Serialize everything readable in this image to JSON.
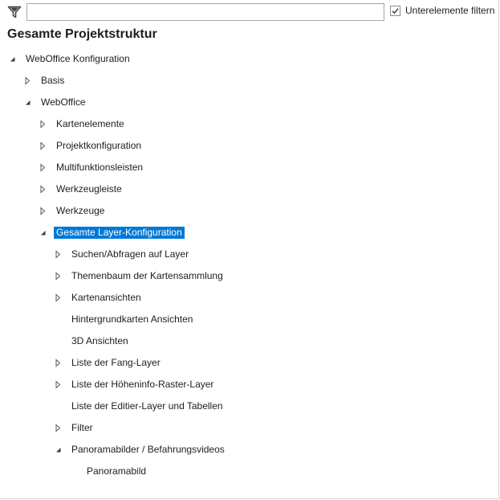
{
  "filter": {
    "input_value": "",
    "icon": "filter-funnel-icon",
    "subelements_label": "Unterelemente filtern",
    "subelements_checked": true
  },
  "title": "Gesamte Projektstruktur",
  "tree": {
    "nodes": [
      {
        "label": "WebOffice Konfiguration",
        "level": 0,
        "state": "expanded",
        "selected": false
      },
      {
        "label": "Basis",
        "level": 1,
        "state": "collapsed",
        "selected": false
      },
      {
        "label": "WebOffice",
        "level": 1,
        "state": "expanded",
        "selected": false
      },
      {
        "label": "Kartenelemente",
        "level": 2,
        "state": "collapsed",
        "selected": false
      },
      {
        "label": "Projektkonfiguration",
        "level": 2,
        "state": "collapsed",
        "selected": false
      },
      {
        "label": "Multifunktionsleisten",
        "level": 2,
        "state": "collapsed",
        "selected": false
      },
      {
        "label": "Werkzeugleiste",
        "level": 2,
        "state": "collapsed",
        "selected": false
      },
      {
        "label": "Werkzeuge",
        "level": 2,
        "state": "collapsed",
        "selected": false
      },
      {
        "label": "Gesamte Layer-Konfiguration",
        "level": 2,
        "state": "expanded",
        "selected": true
      },
      {
        "label": "Suchen/Abfragen auf Layer",
        "level": 3,
        "state": "collapsed",
        "selected": false
      },
      {
        "label": "Themenbaum der Kartensammlung",
        "level": 3,
        "state": "collapsed",
        "selected": false
      },
      {
        "label": "Kartenansichten",
        "level": 3,
        "state": "collapsed",
        "selected": false
      },
      {
        "label": "Hintergrundkarten Ansichten",
        "level": 3,
        "state": "leaf",
        "selected": false
      },
      {
        "label": "3D Ansichten",
        "level": 3,
        "state": "leaf",
        "selected": false
      },
      {
        "label": "Liste der Fang-Layer",
        "level": 3,
        "state": "collapsed",
        "selected": false
      },
      {
        "label": "Liste der Höheninfo-Raster-Layer",
        "level": 3,
        "state": "collapsed",
        "selected": false
      },
      {
        "label": "Liste der Editier-Layer und Tabellen",
        "level": 3,
        "state": "leaf",
        "selected": false
      },
      {
        "label": "Filter",
        "level": 3,
        "state": "collapsed",
        "selected": false
      },
      {
        "label": "Panoramabilder / Befahrungsvideos",
        "level": 3,
        "state": "expanded",
        "selected": false
      },
      {
        "label": "Panoramabild",
        "level": 4,
        "state": "leaf",
        "selected": false
      }
    ]
  },
  "colors": {
    "selection": "#0078d7",
    "glyph": "#5a5a5a"
  }
}
